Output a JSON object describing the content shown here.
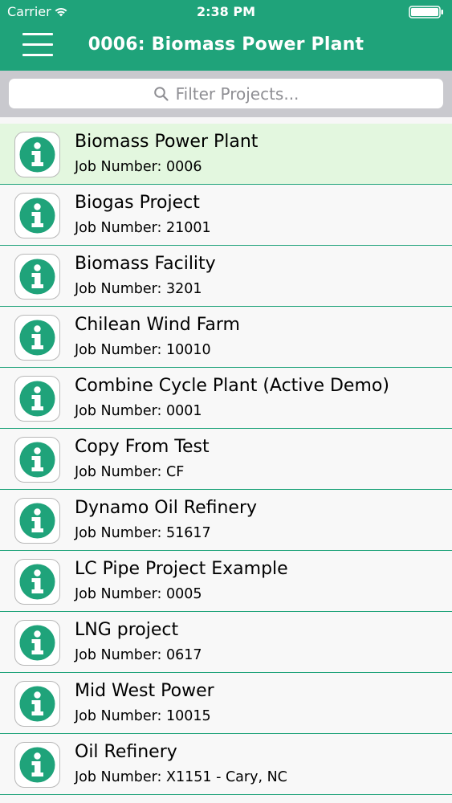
{
  "status_bar": {
    "carrier": "Carrier",
    "time": "2:38 PM",
    "wifi_icon": "wifi-icon",
    "battery_icon": "battery-icon"
  },
  "nav_bar": {
    "title": "0006: Biomass Power Plant",
    "menu_icon": "hamburger-menu-icon",
    "background_color": "#1fa37a"
  },
  "search": {
    "placeholder": "Filter Projects...",
    "icon": "search-icon"
  },
  "colors": {
    "accent": "#1fa37a",
    "selected_row": "#e3f7df",
    "separator": "#1fa37a"
  },
  "projects": [
    {
      "name": "Biomass Power Plant",
      "job": "Job Number: 0006",
      "selected": true,
      "icon": "info-icon"
    },
    {
      "name": "Biogas Project",
      "job": "Job Number: 21001",
      "selected": false,
      "icon": "info-icon"
    },
    {
      "name": "Biomass Facility",
      "job": "Job Number: 3201",
      "selected": false,
      "icon": "info-icon"
    },
    {
      "name": "Chilean Wind Farm",
      "job": "Job Number: 10010",
      "selected": false,
      "icon": "info-icon"
    },
    {
      "name": "Combine Cycle Plant (Active Demo)",
      "job": "Job Number: 0001",
      "selected": false,
      "icon": "info-icon"
    },
    {
      "name": "Copy From Test",
      "job": "Job Number: CF",
      "selected": false,
      "icon": "info-icon"
    },
    {
      "name": "Dynamo Oil Refinery",
      "job": "Job Number: 51617",
      "selected": false,
      "icon": "info-icon"
    },
    {
      "name": "LC Pipe Project Example",
      "job": "Job Number: 0005",
      "selected": false,
      "icon": "info-icon"
    },
    {
      "name": "LNG project",
      "job": "Job Number: 0617",
      "selected": false,
      "icon": "info-icon"
    },
    {
      "name": "Mid West Power",
      "job": "Job Number: 10015",
      "selected": false,
      "icon": "info-icon"
    },
    {
      "name": "Oil Refinery",
      "job": "Job Number: X1151 - Cary, NC",
      "selected": false,
      "icon": "info-icon"
    }
  ]
}
